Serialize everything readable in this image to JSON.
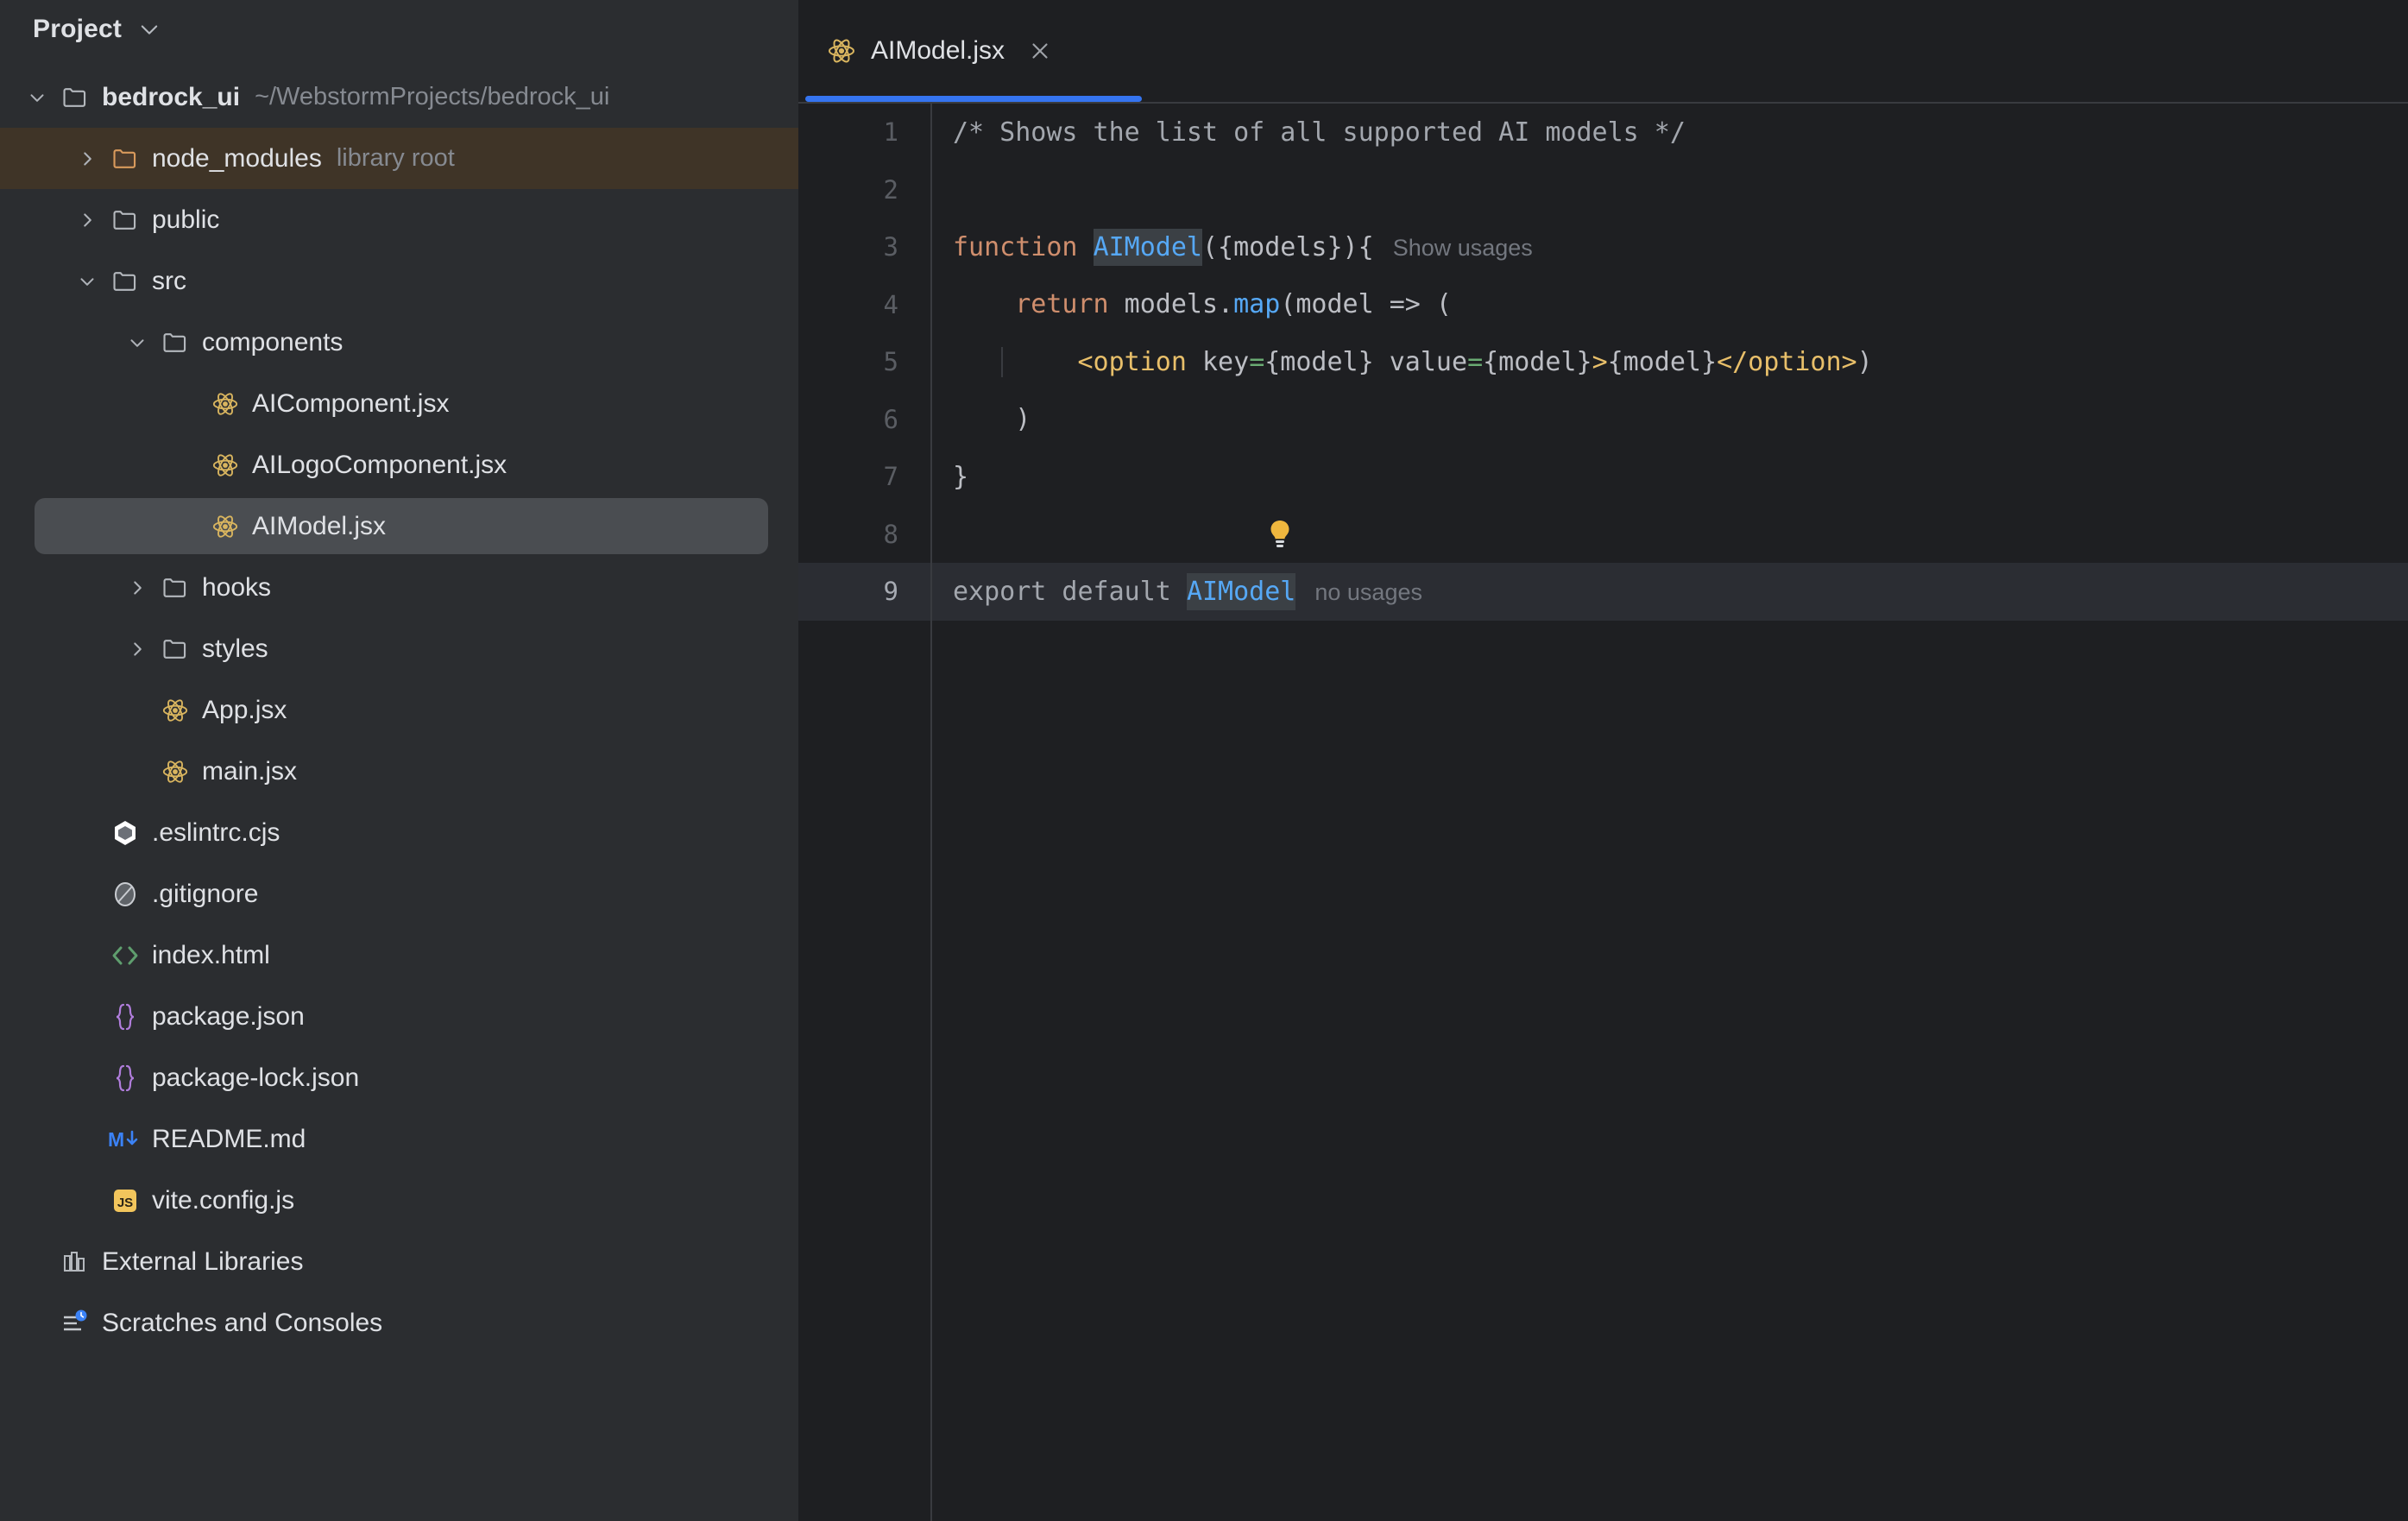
{
  "sidebar": {
    "header": {
      "title": "Project",
      "collapse_icon": "chevron-down-icon"
    },
    "tree": [
      {
        "label": "bedrock_ui",
        "hint": "~/WebstormProjects/bedrock_ui",
        "icon": "folder-icon",
        "twisty": "chevron-down-icon",
        "indent": 0,
        "bold": true,
        "state": "normal"
      },
      {
        "label": "node_modules",
        "hint": "library root",
        "icon": "folder-library-icon",
        "twisty": "chevron-right-icon",
        "indent": 1,
        "bold": false,
        "state": "highlighted"
      },
      {
        "label": "public",
        "hint": "",
        "icon": "folder-icon",
        "twisty": "chevron-right-icon",
        "indent": 1,
        "bold": false,
        "state": "normal"
      },
      {
        "label": "src",
        "hint": "",
        "icon": "folder-icon",
        "twisty": "chevron-down-icon",
        "indent": 1,
        "bold": false,
        "state": "normal"
      },
      {
        "label": "components",
        "hint": "",
        "icon": "folder-icon",
        "twisty": "chevron-down-icon",
        "indent": 2,
        "bold": false,
        "state": "normal"
      },
      {
        "label": "AIComponent.jsx",
        "hint": "",
        "icon": "react-jsx-icon",
        "twisty": "",
        "indent": 3,
        "bold": false,
        "state": "normal"
      },
      {
        "label": "AILogoComponent.jsx",
        "hint": "",
        "icon": "react-jsx-icon",
        "twisty": "",
        "indent": 3,
        "bold": false,
        "state": "normal"
      },
      {
        "label": "AIModel.jsx",
        "hint": "",
        "icon": "react-jsx-icon",
        "twisty": "",
        "indent": 3,
        "bold": false,
        "state": "selected"
      },
      {
        "label": "hooks",
        "hint": "",
        "icon": "folder-icon",
        "twisty": "chevron-right-icon",
        "indent": 2,
        "bold": false,
        "state": "normal"
      },
      {
        "label": "styles",
        "hint": "",
        "icon": "folder-icon",
        "twisty": "chevron-right-icon",
        "indent": 2,
        "bold": false,
        "state": "normal"
      },
      {
        "label": "App.jsx",
        "hint": "",
        "icon": "react-jsx-icon",
        "twisty": "",
        "indent": 2,
        "bold": false,
        "state": "normal"
      },
      {
        "label": "main.jsx",
        "hint": "",
        "icon": "react-jsx-icon",
        "twisty": "",
        "indent": 2,
        "bold": false,
        "state": "normal"
      },
      {
        "label": ".eslintrc.cjs",
        "hint": "",
        "icon": "eslint-icon",
        "twisty": "",
        "indent": 1,
        "bold": false,
        "state": "normal"
      },
      {
        "label": ".gitignore",
        "hint": "",
        "icon": "gitignore-icon",
        "twisty": "",
        "indent": 1,
        "bold": false,
        "state": "normal"
      },
      {
        "label": "index.html",
        "hint": "",
        "icon": "html-icon",
        "twisty": "",
        "indent": 1,
        "bold": false,
        "state": "normal"
      },
      {
        "label": "package.json",
        "hint": "",
        "icon": "json-icon",
        "twisty": "",
        "indent": 1,
        "bold": false,
        "state": "normal"
      },
      {
        "label": "package-lock.json",
        "hint": "",
        "icon": "json-icon",
        "twisty": "",
        "indent": 1,
        "bold": false,
        "state": "normal"
      },
      {
        "label": "README.md",
        "hint": "",
        "icon": "markdown-icon",
        "twisty": "",
        "indent": 1,
        "bold": false,
        "state": "normal"
      },
      {
        "label": "vite.config.js",
        "hint": "",
        "icon": "javascript-icon",
        "twisty": "",
        "indent": 1,
        "bold": false,
        "state": "normal"
      },
      {
        "label": "External Libraries",
        "hint": "",
        "icon": "external-libraries-icon",
        "twisty": "",
        "indent": 0,
        "bold": false,
        "state": "normal"
      },
      {
        "label": "Scratches and Consoles",
        "hint": "",
        "icon": "scratches-icon",
        "twisty": "",
        "indent": 0,
        "bold": false,
        "state": "normal"
      }
    ]
  },
  "editor": {
    "tab": {
      "label": "AIModel.jsx",
      "icon": "react-jsx-icon",
      "close_icon": "close-icon"
    },
    "accent_color": "#3574f0",
    "lines": [
      {
        "num": "1"
      },
      {
        "num": "2"
      },
      {
        "num": "3"
      },
      {
        "num": "4"
      },
      {
        "num": "5"
      },
      {
        "num": "6"
      },
      {
        "num": "7"
      },
      {
        "num": "8"
      },
      {
        "num": "9"
      }
    ],
    "code": {
      "l1_comment": "/* Shows the list of all supported AI models */",
      "l3_kw": "function",
      "l3_space1": " ",
      "l3_name": "AIModel",
      "l3_params": "({models}){",
      "l3_inlay": "Show usages",
      "l4_indent": "    ",
      "l4_kw": "return",
      "l4_obj": " models.",
      "l4_method": "map",
      "l4_rest": "(model => (",
      "l5_indent": "        ",
      "l5_open": "<option",
      "l5_attr1": " key",
      "l5_eq1": "=",
      "l5_val1": "{model}",
      "l5_attr2": " value",
      "l5_eq2": "=",
      "l5_val2": "{model}",
      "l5_gt": ">",
      "l5_child": "{model}",
      "l5_close": "</option>",
      "l5_paren": ")",
      "l6": "    )",
      "l7": "}",
      "l8_icon": "lightbulb-icon",
      "l9_kw": "export default ",
      "l9_name": "AIModel",
      "l9_inlay": "no usages"
    }
  }
}
